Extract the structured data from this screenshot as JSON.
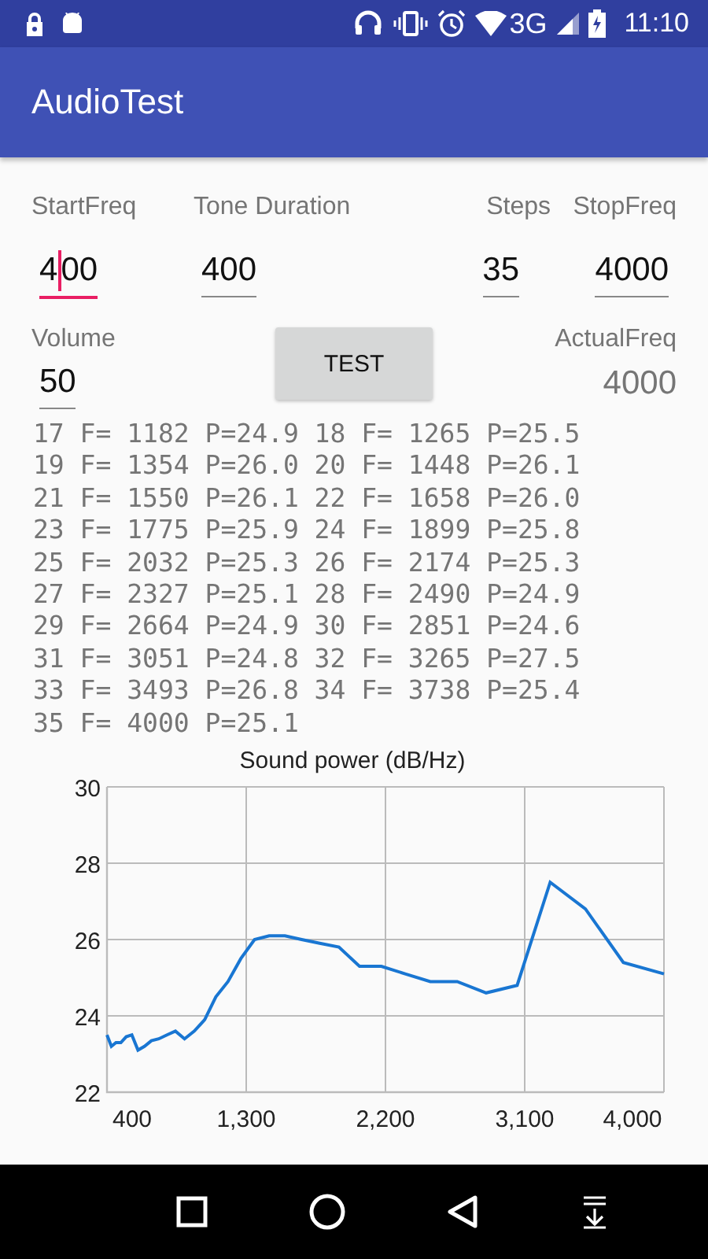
{
  "status_bar": {
    "network": "3G",
    "time": "11:10"
  },
  "app_bar": {
    "title": "AudioTest"
  },
  "fields": [
    {
      "label": "StartFreq",
      "value": "400",
      "focused": true
    },
    {
      "label": "Tone Duration",
      "value": "400",
      "focused": false
    },
    {
      "label": "Steps",
      "value": "35",
      "focused": false
    },
    {
      "label": "StopFreq",
      "value": "4000",
      "focused": false
    }
  ],
  "volume": {
    "label": "Volume",
    "value": "50",
    "focused": false
  },
  "test_button": {
    "label": "TEST"
  },
  "actual_freq": {
    "label": "ActualFreq",
    "value": "4000"
  },
  "log_lines": [
    "17 F= 1182 P=24.9 18 F= 1265 P=25.5",
    "19 F= 1354 P=26.0 20 F= 1448 P=26.1",
    "21 F= 1550 P=26.1 22 F= 1658 P=26.0",
    "23 F= 1775 P=25.9 24 F= 1899 P=25.8",
    "25 F= 2032 P=25.3 26 F= 2174 P=25.3",
    "27 F= 2327 P=25.1 28 F= 2490 P=24.9",
    "29 F= 2664 P=24.9 30 F= 2851 P=24.6",
    "31 F= 3051 P=24.8 32 F= 3265 P=27.5",
    "33 F= 3493 P=26.8 34 F= 3738 P=25.4",
    "35 F= 4000 P=25.1"
  ],
  "chart": {
    "chart_data": {
      "type": "line",
      "title": "Sound power (dB/Hz)",
      "x": [
        400,
        428,
        458,
        490,
        524,
        561,
        600,
        642,
        687,
        735,
        787,
        842,
        901,
        964,
        1032,
        1104,
        1182,
        1265,
        1354,
        1448,
        1550,
        1658,
        1775,
        1899,
        2032,
        2174,
        2327,
        2490,
        2664,
        2851,
        3051,
        3265,
        3493,
        3738,
        4000
      ],
      "series": [
        {
          "color": "#1976d2",
          "values": [
            23.5,
            23.2,
            23.3,
            23.3,
            23.45,
            23.5,
            23.1,
            23.2,
            23.35,
            23.4,
            23.5,
            23.6,
            23.4,
            23.6,
            23.9,
            24.5,
            24.9,
            25.5,
            26.0,
            26.1,
            26.1,
            26.0,
            25.9,
            25.8,
            25.3,
            25.3,
            25.1,
            24.9,
            24.9,
            24.6,
            24.8,
            27.5,
            26.8,
            25.4,
            25.1
          ]
        }
      ],
      "xlim": [
        400,
        4000
      ],
      "ylim": [
        22,
        30
      ],
      "xticks": [
        {
          "value": 400,
          "label": "400"
        },
        {
          "value": 1300,
          "label": "1,300"
        },
        {
          "value": 2200,
          "label": "2,200"
        },
        {
          "value": 3100,
          "label": "3,100"
        },
        {
          "value": 4000,
          "label": "4,000"
        }
      ],
      "yticks": [
        22,
        24,
        26,
        28,
        30
      ],
      "grid": true
    }
  }
}
